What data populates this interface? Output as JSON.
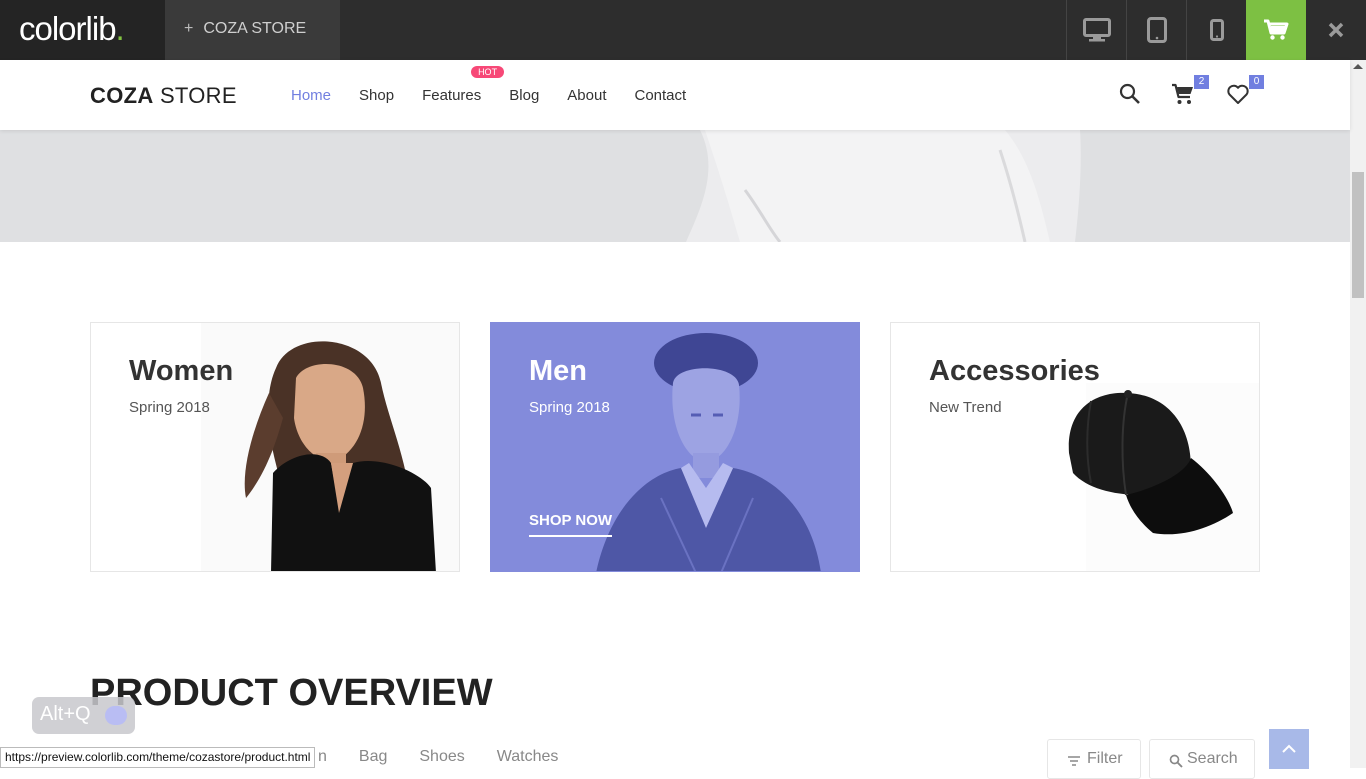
{
  "preview_bar": {
    "logo_text": "colorlib",
    "logo_dot": ".",
    "tab_label": "COZA STORE",
    "tab_plus": "+",
    "icons": [
      "desktop-icon",
      "tablet-icon",
      "mobile-icon",
      "cart-icon",
      "close-icon"
    ],
    "accent": "#7dc043"
  },
  "header": {
    "brand_bold": "COZA",
    "brand_light": " STORE",
    "nav": [
      "Home",
      "Shop",
      "Features",
      "Blog",
      "About",
      "Contact"
    ],
    "hot_badge": "HOT",
    "cart_count": "2",
    "wishlist_count": "0",
    "accent": "#717fe0"
  },
  "banners": [
    {
      "title": "Women",
      "subtitle": "Spring 2018"
    },
    {
      "title": "Men",
      "subtitle": "Spring 2018",
      "cta": "SHOP NOW"
    },
    {
      "title": "Accessories",
      "subtitle": "New Trend"
    }
  ],
  "product_overview": {
    "title": "PRODUCT OVERVIEW",
    "filters_visible": [
      "n",
      "Bag",
      "Shoes",
      "Watches"
    ],
    "filter_button": "Filter",
    "search_button": "Search"
  },
  "status_url": "https://preview.colorlib.com/theme/cozastore/product.html",
  "shortcut_overlay": "Alt+Q"
}
